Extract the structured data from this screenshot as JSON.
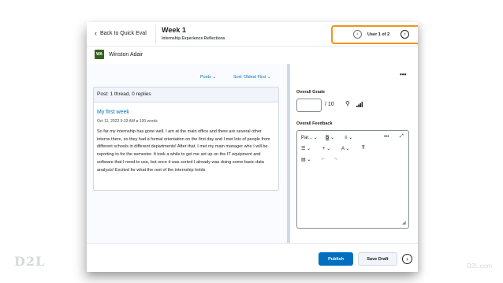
{
  "page": {
    "logo_text": "D2L",
    "url_text": "D2L.com"
  },
  "header": {
    "back_label": "Back to Quick Eval",
    "title": "Week 1",
    "subtitle": "Internship Experience Reflections",
    "user_counter": "User 1 of 2"
  },
  "user": {
    "initials": "WA",
    "name": "Winston Adair",
    "avatar_color": "#33621e"
  },
  "discussion": {
    "posts_filter": "Posts",
    "sort_label": "Sort: Oldest First",
    "summary": "Post: 1 thread, 0 replies",
    "post": {
      "title": "My first week",
      "meta": "Oct 11, 2022 9:33 AM ● 100 words",
      "body": "So far my internship has gone well. I am at the main office and there are several other interns there, so they had a formal orientation on the first day and I met lots of people from different schools in different departments! After that, I met my main manager who I will be reporting to for the semester. It took a while to get me set up on the IT equipment and software that I need to use, but once it was sorted I already was doing some basic data analysis! Excited for what the rest of the internship holds."
    }
  },
  "grading": {
    "grade_label": "Overall Grade",
    "grade_value": "",
    "out_of": "/ 10",
    "feedback_label": "Overall Feedback",
    "toolbar": {
      "paragraph": "Par...",
      "bold": "B",
      "align": "≡",
      "more": "•••",
      "list": "☰",
      "insert": "+",
      "text_style": "A",
      "format_painter": "T",
      "table": "▤",
      "undo": "↶",
      "redo": "↷"
    }
  },
  "footer": {
    "publish_label": "Publish",
    "save_draft_label": "Save Draft"
  },
  "colors": {
    "accent": "#006fbf",
    "highlight": "#f2941a"
  },
  "icons": [
    "chevron-left-icon",
    "chevron-right-icon",
    "more-icon",
    "rubric-pin-icon",
    "stats-icon",
    "expand-icon",
    "resize-icon"
  ]
}
